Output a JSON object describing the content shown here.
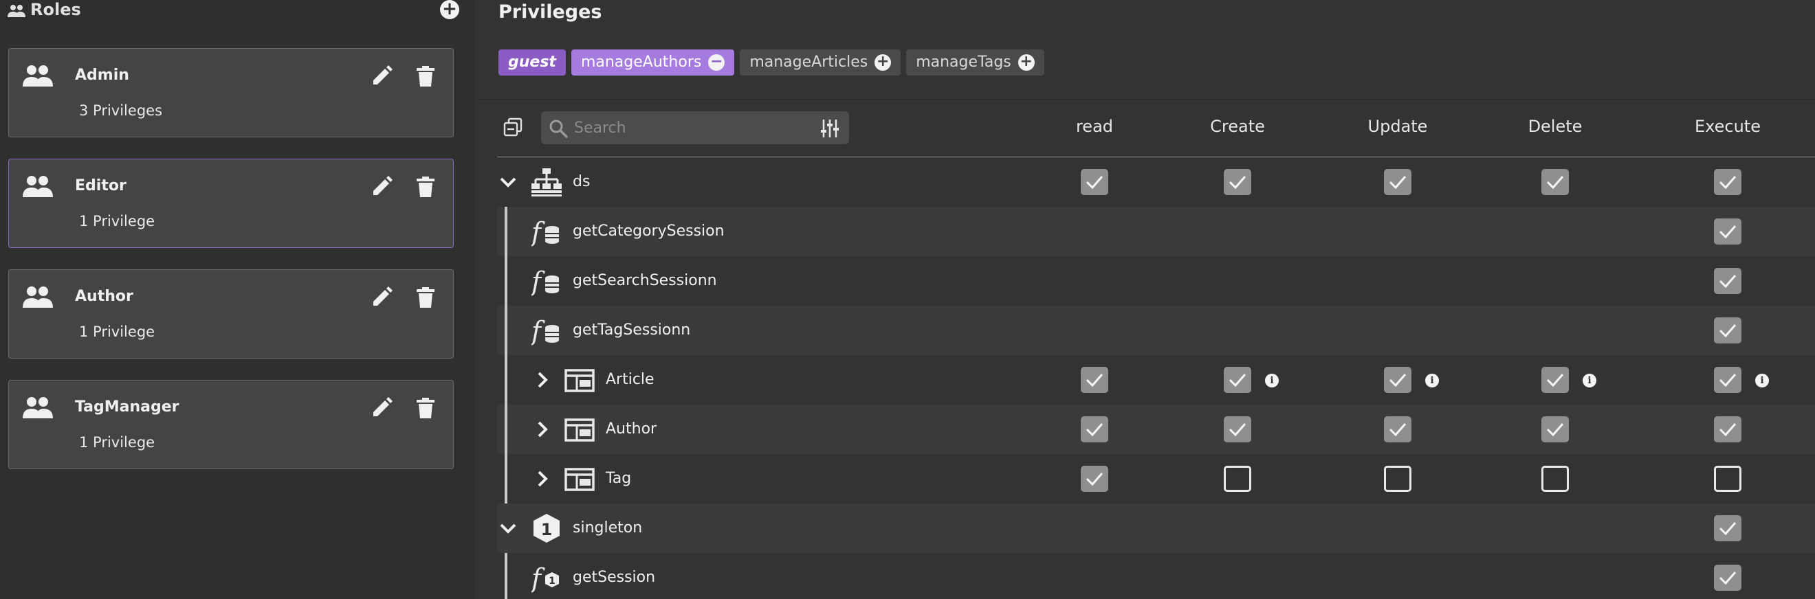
{
  "sidebar": {
    "title": "Roles",
    "roles": [
      {
        "name": "Admin",
        "privileges": "3 Privileges",
        "selected": false
      },
      {
        "name": "Editor",
        "privileges": "1 Privilege",
        "selected": true
      },
      {
        "name": "Author",
        "privileges": "1 Privilege",
        "selected": false
      },
      {
        "name": "TagManager",
        "privileges": "1 Privilege",
        "selected": false
      }
    ]
  },
  "main": {
    "title": "Privileges",
    "tags": [
      {
        "label": "guest",
        "state": "guest"
      },
      {
        "label": "manageAuthors",
        "state": "active",
        "action": "−"
      },
      {
        "label": "manageArticles",
        "state": "inactive",
        "action": "+"
      },
      {
        "label": "manageTags",
        "state": "inactive",
        "action": "+"
      }
    ],
    "search": {
      "placeholder": "Search",
      "value": ""
    },
    "columns": [
      "read",
      "Create",
      "Update",
      "Delete",
      "Execute"
    ],
    "rows": [
      {
        "label": "ds",
        "type": "datasource",
        "expanded": true,
        "level": 0,
        "read": true,
        "create": true,
        "update": true,
        "delete": true,
        "execute": true
      },
      {
        "label": "getCategorySession",
        "type": "function",
        "level": 1,
        "execute": true
      },
      {
        "label": "getSearchSessionn",
        "type": "function",
        "level": 1,
        "execute": true
      },
      {
        "label": "getTagSessionn",
        "type": "function",
        "level": 1,
        "execute": true
      },
      {
        "label": "Article",
        "type": "entity",
        "expanded": false,
        "level": 1,
        "read": true,
        "create": true,
        "update": true,
        "delete": true,
        "execute": true,
        "info": true
      },
      {
        "label": "Author",
        "type": "entity",
        "expanded": false,
        "level": 1,
        "read": true,
        "create": true,
        "update": true,
        "delete": true,
        "execute": true
      },
      {
        "label": "Tag",
        "type": "entity",
        "expanded": false,
        "level": 1,
        "read": true,
        "create": false,
        "update": false,
        "delete": false,
        "execute": false
      },
      {
        "label": "singleton",
        "type": "singleton",
        "expanded": true,
        "level": 0,
        "execute": true
      },
      {
        "label": "getSession",
        "type": "singleton-function",
        "level": 1,
        "execute": true
      }
    ]
  },
  "colors": {
    "accent": "#a57be0",
    "guest": "#8a5cc4",
    "checked": "#8f8f8f"
  }
}
